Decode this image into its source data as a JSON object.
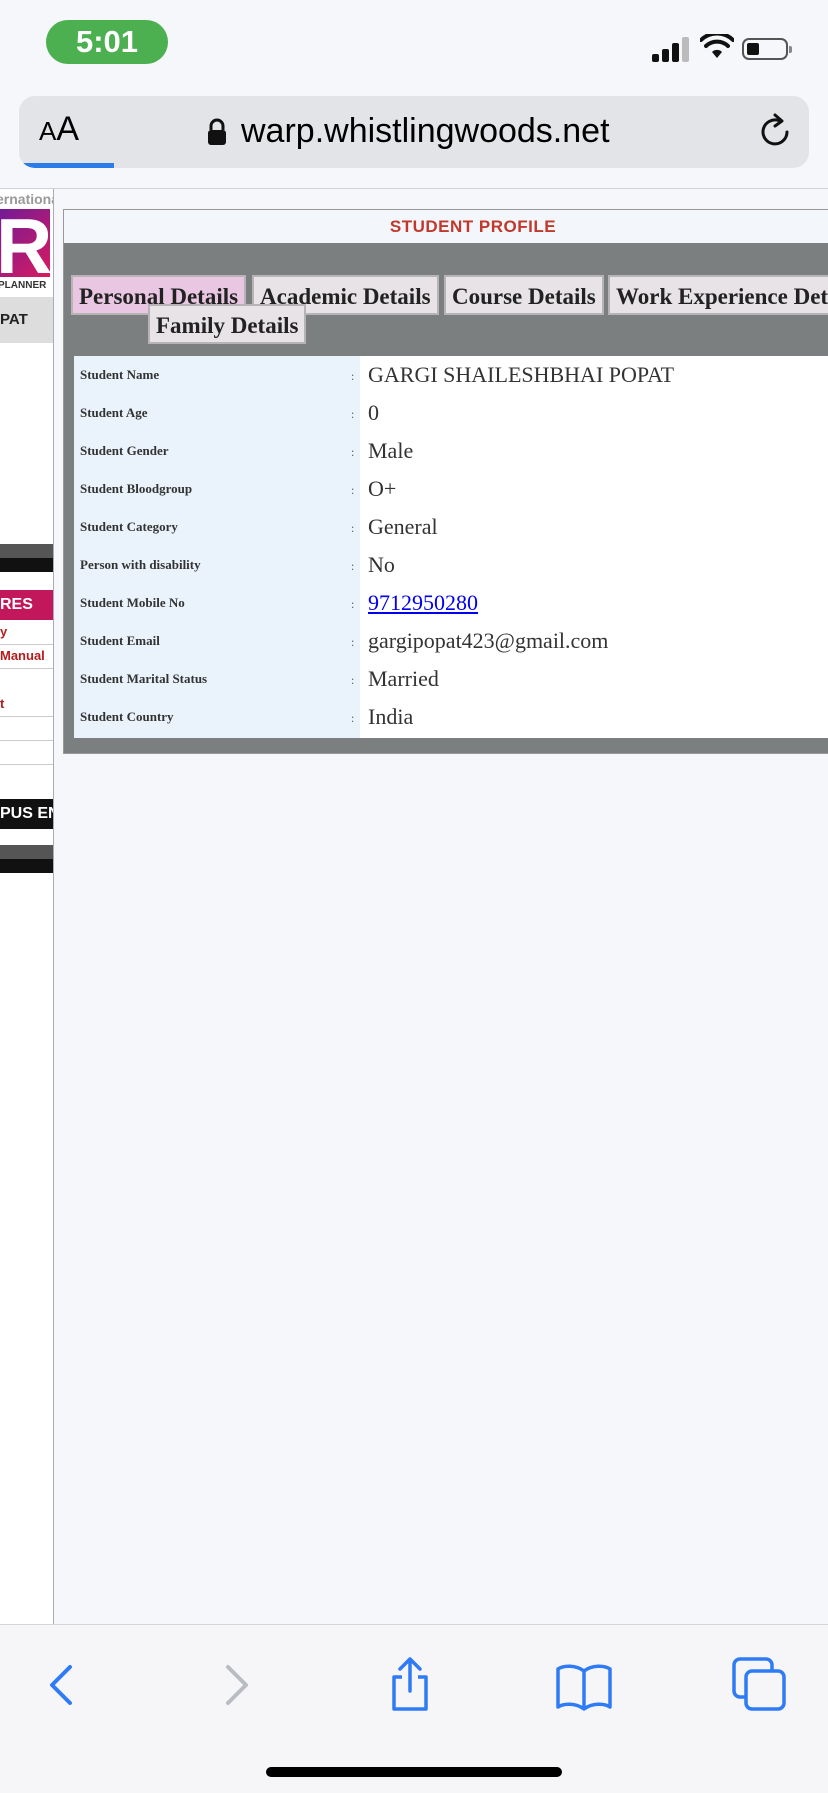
{
  "status_bar": {
    "time": "5:01"
  },
  "browser": {
    "text_size_button": {
      "small": "A",
      "large": "A"
    },
    "url": "warp.whistlingwoods.net",
    "accent": "#2b7be8"
  },
  "sidebar": {
    "brand_text": "ernationa",
    "logo_caption": "PLANNER",
    "name_fragment": "PAT",
    "section_label": "RES",
    "links": [
      "y",
      "Manual",
      "t"
    ],
    "campus_label": "PUS EN"
  },
  "profile": {
    "title": "STUDENT PROFILE",
    "tabs": [
      {
        "label": "Personal Details",
        "active": true
      },
      {
        "label": "Academic Details",
        "active": false
      },
      {
        "label": "Course Details",
        "active": false
      },
      {
        "label": "Work Experience Details",
        "active": false
      },
      {
        "label": "Family Details",
        "active": false
      }
    ],
    "fields": [
      {
        "label": "Student Name",
        "value": "GARGI SHAILESHBHAI POPAT"
      },
      {
        "label": "Student Age",
        "value": "0"
      },
      {
        "label": "Student Gender",
        "value": "Male"
      },
      {
        "label": "Student Bloodgroup",
        "value": "O+"
      },
      {
        "label": "Student Category",
        "value": "General"
      },
      {
        "label": "Person with disability",
        "value": "No"
      },
      {
        "label": "Student Mobile No",
        "value": "9712950280"
      },
      {
        "label": "Student Email",
        "value": "gargipopat423@gmail.com"
      },
      {
        "label": "Student Marital Status",
        "value": "Married"
      },
      {
        "label": "Student Country",
        "value": "India"
      }
    ],
    "colon": ":",
    "title_color": "#c0392b"
  },
  "toolbar": {
    "icons": [
      "back-icon",
      "forward-icon",
      "share-icon",
      "bookmarks-icon",
      "tabs-icon"
    ]
  }
}
